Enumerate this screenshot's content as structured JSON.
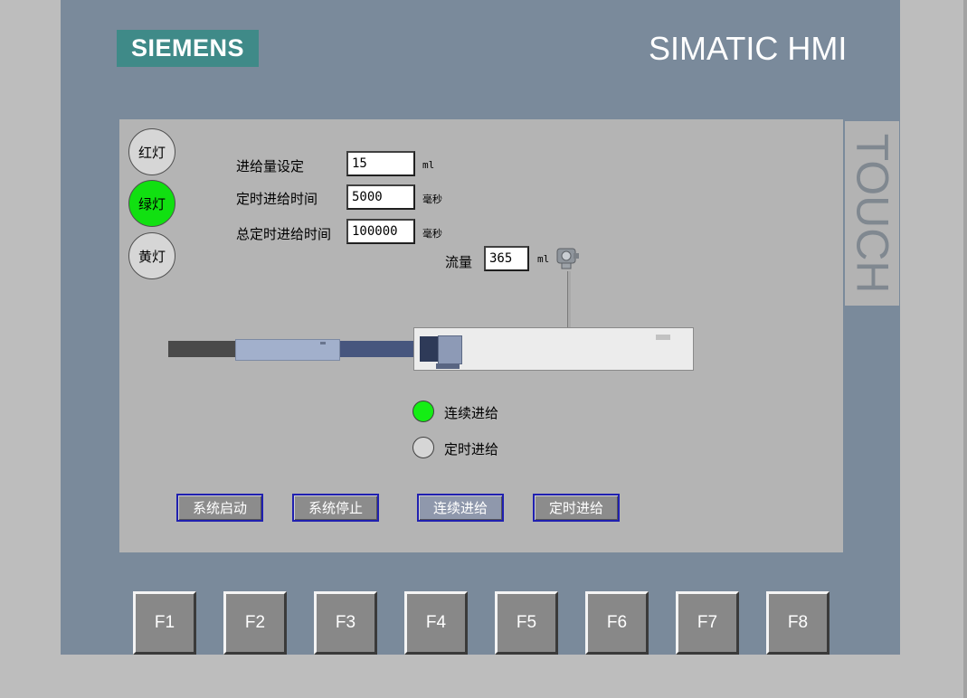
{
  "brand": {
    "logo_text": "SIEMENS",
    "product": "SIMATIC HMI",
    "touch_label": "TOUCH"
  },
  "lamps": [
    {
      "label": "红灯",
      "state": "off"
    },
    {
      "label": "绿灯",
      "state": "on"
    },
    {
      "label": "黄灯",
      "state": "off"
    }
  ],
  "params": {
    "feed_amount": {
      "label": "进给量设定",
      "value": "15",
      "unit": "ml"
    },
    "timed_feed_time": {
      "label": "定时进给时间",
      "value": "5000",
      "unit": "毫秒"
    },
    "total_timed_feed_time": {
      "label": "总定时进给时间",
      "value": "100000",
      "unit": "毫秒"
    },
    "flow": {
      "label": "流量",
      "value": "365",
      "unit": "ml"
    }
  },
  "indicators": [
    {
      "label": "连续进给",
      "state": "on"
    },
    {
      "label": "定时进给",
      "state": "off"
    }
  ],
  "buttons": {
    "system_start": "系统启动",
    "system_stop": "系统停止",
    "continuous_feed": "连续进给",
    "timed_feed": "定时进给"
  },
  "function_keys": [
    "F1",
    "F2",
    "F3",
    "F4",
    "F5",
    "F6",
    "F7",
    "F8"
  ],
  "colors": {
    "bezel": "#7a8a9b",
    "logo_bg": "#3f8a88",
    "lamp_on": "#11e011",
    "button_border": "#2020b0"
  }
}
